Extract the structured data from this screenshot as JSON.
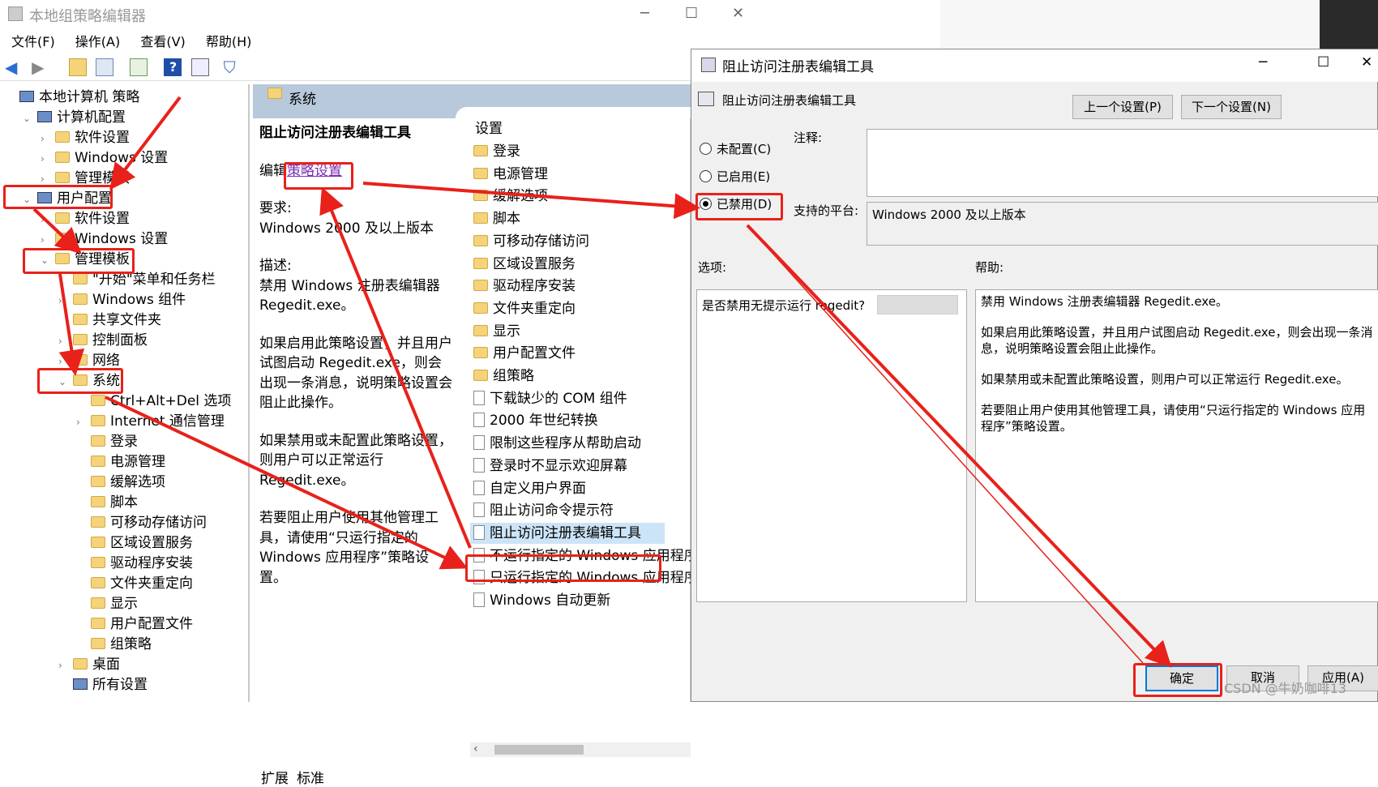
{
  "main_window": {
    "title": "本地组策略编辑器",
    "controls": [
      "─",
      "☐",
      "✕"
    ],
    "menus": [
      "文件(F)",
      "操作(A)",
      "查看(V)",
      "帮助(H)"
    ]
  },
  "tree": [
    {
      "label": "本地计算机 策略",
      "level": 0,
      "icon": "policy-icon"
    },
    {
      "label": "计算机配置",
      "level": 1,
      "icon": "computer-icon",
      "exp": "⌄"
    },
    {
      "label": "软件设置",
      "level": 2,
      "exp": "›"
    },
    {
      "label": "Windows 设置",
      "level": 2,
      "exp": "›"
    },
    {
      "label": "管理模板",
      "level": 2,
      "exp": "›"
    },
    {
      "label": "用户配置",
      "level": 1,
      "icon": "user-icon",
      "exp": "⌄"
    },
    {
      "label": "软件设置",
      "level": 2,
      "exp": "›"
    },
    {
      "label": "Windows 设置",
      "level": 2,
      "exp": "›"
    },
    {
      "label": "管理模板",
      "level": 2,
      "exp": "⌄"
    },
    {
      "label": "\"开始\"菜单和任务栏",
      "level": 3,
      "exp": ""
    },
    {
      "label": "Windows 组件",
      "level": 3,
      "exp": "›"
    },
    {
      "label": "共享文件夹",
      "level": 3,
      "exp": ""
    },
    {
      "label": "控制面板",
      "level": 3,
      "exp": "›"
    },
    {
      "label": "网络",
      "level": 3,
      "exp": "›"
    },
    {
      "label": "系统",
      "level": 3,
      "exp": "⌄"
    },
    {
      "label": "Ctrl+Alt+Del 选项",
      "level": 4,
      "exp": ""
    },
    {
      "label": "Internet 通信管理",
      "level": 4,
      "exp": "›"
    },
    {
      "label": "登录",
      "level": 4,
      "exp": ""
    },
    {
      "label": "电源管理",
      "level": 4,
      "exp": ""
    },
    {
      "label": "缓解选项",
      "level": 4,
      "exp": ""
    },
    {
      "label": "脚本",
      "level": 4,
      "exp": ""
    },
    {
      "label": "可移动存储访问",
      "level": 4,
      "exp": ""
    },
    {
      "label": "区域设置服务",
      "level": 4,
      "exp": ""
    },
    {
      "label": "驱动程序安装",
      "level": 4,
      "exp": ""
    },
    {
      "label": "文件夹重定向",
      "level": 4,
      "exp": ""
    },
    {
      "label": "显示",
      "level": 4,
      "exp": ""
    },
    {
      "label": "用户配置文件",
      "level": 4,
      "exp": ""
    },
    {
      "label": "组策略",
      "level": 4,
      "exp": ""
    },
    {
      "label": "桌面",
      "level": 3,
      "exp": "›"
    },
    {
      "label": "所有设置",
      "level": 3,
      "exp": "",
      "icon": "all-settings-icon"
    }
  ],
  "detail": {
    "header": "系统",
    "policy_title": "阻止访问注册表编辑工具",
    "edit_prefix": "编辑",
    "edit_link": "策略设置",
    "req_label": "要求:",
    "req_value": "Windows 2000 及以上版本",
    "desc_label": "描述:",
    "desc_1": "禁用 Windows 注册表编辑器 Regedit.exe。",
    "desc_2": "如果启用此策略设置，并且用户试图启动 Regedit.exe，则会出现一条消息，说明策略设置会阻止此操作。",
    "desc_3": "如果禁用或未配置此策略设置，则用户可以正常运行 Regedit.exe。",
    "desc_4": "若要阻止用户使用其他管理工具，请使用“只运行指定的 Windows 应用程序”策略设置。",
    "list_header": "设置",
    "folders": [
      "登录",
      "电源管理",
      "缓解选项",
      "脚本",
      "可移动存储访问",
      "区域设置服务",
      "驱动程序安装",
      "文件夹重定向",
      "显示",
      "用户配置文件",
      "组策略"
    ],
    "policies": [
      "下载缺少的 COM 组件",
      "2000 年世纪转换",
      "限制这些程序从帮助启动",
      "登录时不显示欢迎屏幕",
      "自定义用户界面",
      "阻止访问命令提示符",
      "阻止访问注册表编辑工具",
      "不运行指定的 Windows 应用程序",
      "只运行指定的 Windows 应用程序",
      "Windows 自动更新"
    ],
    "scroll_left": "‹",
    "tabs": [
      "扩展",
      "标准"
    ]
  },
  "dialog": {
    "title": "阻止访问注册表编辑工具",
    "subtitle": "阻止访问注册表编辑工具",
    "controls": [
      "─",
      "☐",
      "✕"
    ],
    "prev_btn": "上一个设置(P)",
    "next_btn": "下一个设置(N)",
    "radios": [
      "未配置(C)",
      "已启用(E)",
      "已禁用(D)"
    ],
    "selected": 2,
    "comment_label": "注释:",
    "platform_label": "支持的平台:",
    "platform_value": "Windows 2000 及以上版本",
    "options_label": "选项:",
    "help_label": "帮助:",
    "option_text": "是否禁用无提示运行 regedit?",
    "help_1": "禁用 Windows 注册表编辑器 Regedit.exe。",
    "help_2": "如果启用此策略设置，并且用户试图启动 Regedit.exe，则会出现一条消息，说明策略设置会阻止此操作。",
    "help_3": "如果禁用或未配置此策略设置，则用户可以正常运行 Regedit.exe。",
    "help_4": "若要阻止用户使用其他管理工具，请使用“只运行指定的 Windows 应用程序”策略设置。",
    "ok_btn": "确定",
    "cancel_btn": "取消",
    "apply_btn": "应用(A)"
  },
  "watermark": "CSDN @牛奶咖啡13",
  "colors": {
    "annotation": "#e8211a",
    "header": "#b9c9dc",
    "link": "#7a2cb0"
  }
}
